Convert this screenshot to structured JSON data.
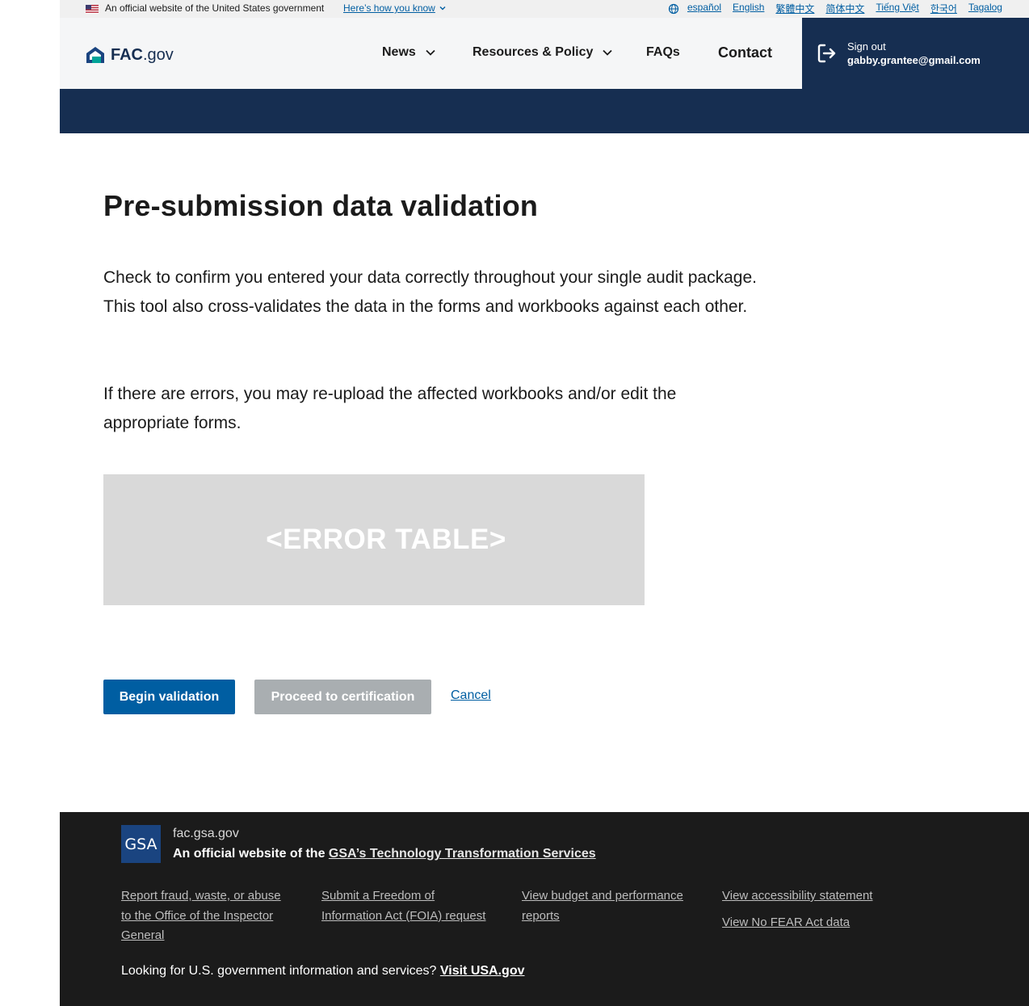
{
  "gov_banner": {
    "official_text": "An official website of the United States government",
    "how_you_know": "Here’s how you know",
    "languages": [
      "español",
      "English",
      "繁體中文",
      "简体中文",
      "Tiếng Việt",
      "한국어",
      "Tagalog"
    ]
  },
  "header": {
    "logo_main": "FAC",
    "logo_suffix": ".gov",
    "nav": {
      "news": "News",
      "resources": "Resources & Policy",
      "faqs": "FAQs",
      "contact": "Contact"
    },
    "signout": {
      "label": "Sign out",
      "email": "gabby.grantee@gmail.com"
    }
  },
  "main": {
    "title": "Pre-submission data validation",
    "paragraph1": "Check to confirm you entered your data correctly throughout your single audit package. This tool also cross-validates the data in the forms and workbooks against each other.",
    "paragraph2": "If there are errors, you may re-upload the affected workbooks and/or edit the appropriate forms.",
    "error_table_placeholder": "<ERROR TABLE>",
    "buttons": {
      "begin": "Begin validation",
      "proceed": "Proceed to certification",
      "cancel": "Cancel"
    }
  },
  "footer": {
    "gsa_logo_text": "GSA",
    "domain": "fac.gsa.gov",
    "official_prefix": "An official website of the ",
    "official_link": "GSA’s Technology Transformation Services",
    "links": {
      "fraud": [
        "Report fraud, waste, or abuse",
        "to the Office of the Inspector",
        "General"
      ],
      "foia": [
        "Submit a Freedom of",
        "Information Act (FOIA) request"
      ],
      "budget": [
        "View budget and performance",
        "reports"
      ],
      "accessibility": "View accessibility statement",
      "nofear": "View No FEAR Act data"
    },
    "usa_prefix": "Looking for U.S. government information and services? ",
    "usa_link": "Visit USA.gov"
  },
  "colors": {
    "primary": "#005ea2",
    "navy": "#162e51",
    "footer_bg": "#1b1b1b",
    "disabled_button": "#a9aeb1",
    "placeholder_bg": "#d9d9d9"
  }
}
